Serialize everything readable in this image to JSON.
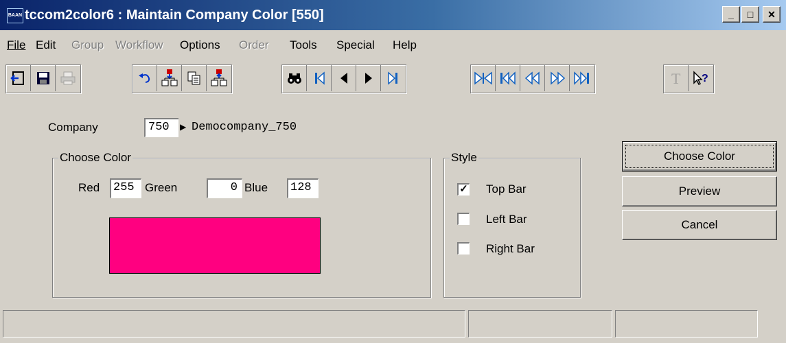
{
  "window": {
    "app_icon_text": "BAAN",
    "title": "tccom2color6 : Maintain Company Color [550]",
    "minimize_glyph": "_",
    "maximize_glyph": "□",
    "close_glyph": "✕"
  },
  "menu": [
    {
      "label": "File",
      "enabled": true
    },
    {
      "label": "Edit",
      "enabled": true
    },
    {
      "label": "Group",
      "enabled": false
    },
    {
      "label": "Workflow",
      "enabled": false
    },
    {
      "label": "Options",
      "enabled": true
    },
    {
      "label": "Order",
      "enabled": false
    },
    {
      "label": "Tools",
      "enabled": true
    },
    {
      "label": "Special",
      "enabled": true
    },
    {
      "label": "Help",
      "enabled": true
    }
  ],
  "toolbar": {
    "icons": [
      "exit-icon",
      "save-icon",
      "print-icon",
      "undo-icon",
      "insert-record-icon",
      "copy-icon",
      "duplicate-record-icon",
      "find-icon",
      "first-record-icon",
      "previous-record-icon",
      "next-record-icon",
      "last-record-icon",
      "first-group-icon",
      "previous-group-icon",
      "previous-set-icon",
      "next-set-icon",
      "last-set-icon",
      "text-icon",
      "help-icon"
    ]
  },
  "company": {
    "label": "Company",
    "value": "750",
    "description": "Democompany_750"
  },
  "choose_color_group": {
    "title": "Choose Color",
    "red_label": "Red",
    "red_value": "255",
    "green_label": "Green",
    "green_value": "0",
    "blue_label": "Blue",
    "blue_value": "128",
    "swatch_color": "#ff0080"
  },
  "style_group": {
    "title": "Style",
    "options": [
      {
        "label": "Top Bar",
        "checked": true
      },
      {
        "label": "Left Bar",
        "checked": false
      },
      {
        "label": "Right Bar",
        "checked": false
      }
    ],
    "check_glyph": "✓"
  },
  "buttons": {
    "choose_color": "Choose Color",
    "preview": "Preview",
    "cancel": "Cancel"
  },
  "colors": {
    "face": "#d4d0c8",
    "title_active": "#0a246a"
  }
}
